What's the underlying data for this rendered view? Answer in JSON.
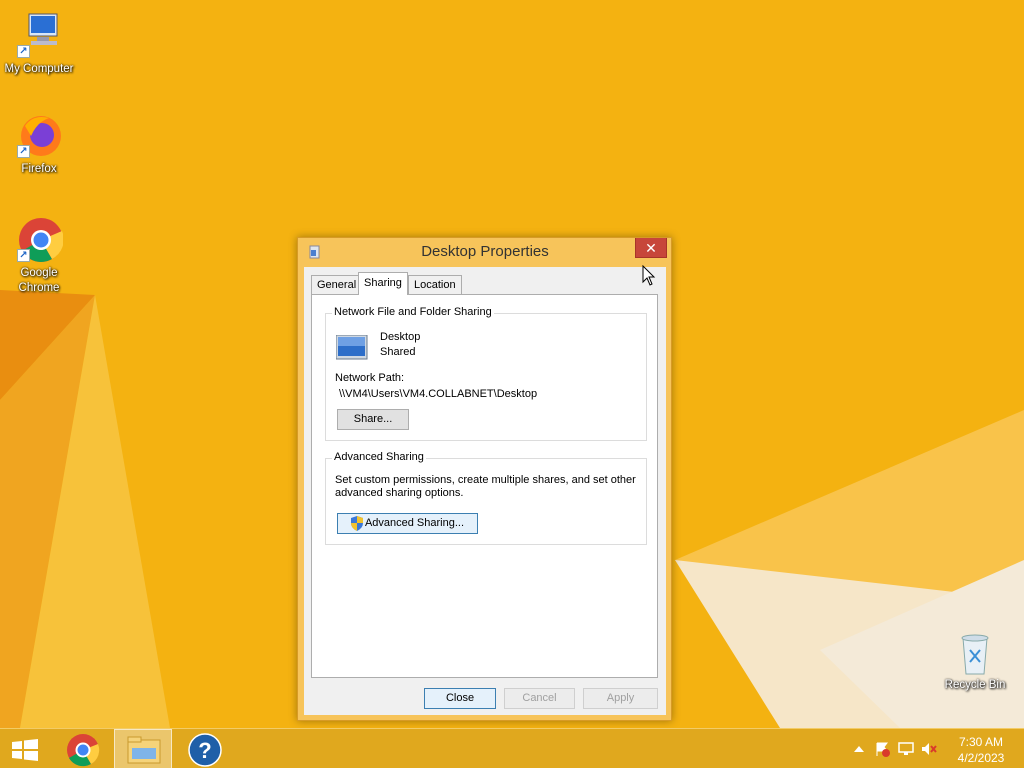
{
  "desktop": {
    "background_color": "#f4b211",
    "icons": [
      {
        "label": "My Computer",
        "icon": "computer-icon"
      },
      {
        "label": "Firefox",
        "icon": "firefox-icon"
      },
      {
        "label": "Google Chrome",
        "icon": "chrome-icon"
      },
      {
        "label": "Recycle Bin",
        "icon": "recycle-bin-icon"
      }
    ]
  },
  "window": {
    "title": "Desktop Properties",
    "close_glyph": "✕",
    "tabs": [
      {
        "label": "General",
        "active": false
      },
      {
        "label": "Sharing",
        "active": true
      },
      {
        "label": "Location",
        "active": false
      }
    ],
    "network_sharing": {
      "legend": "Network File and Folder Sharing",
      "folder_name": "Desktop",
      "folder_status": "Shared",
      "path_label": "Network Path:",
      "path_value": "\\\\VM4\\Users\\VM4.COLLABNET\\Desktop",
      "share_button": "Share..."
    },
    "advanced_sharing": {
      "legend": "Advanced Sharing",
      "description_line1": "Set custom permissions, create multiple shares, and set other",
      "description_line2": "advanced sharing options.",
      "button": "Advanced Sharing..."
    },
    "footer": {
      "close": "Close",
      "cancel": "Cancel",
      "apply": "Apply"
    }
  },
  "taskbar": {
    "items": [
      {
        "name": "start",
        "icon": "windows-logo-icon"
      },
      {
        "name": "chrome",
        "icon": "chrome-icon"
      },
      {
        "name": "file-explorer",
        "icon": "folder-icon",
        "active": true
      },
      {
        "name": "help",
        "icon": "help-icon"
      }
    ],
    "tray": {
      "icons": [
        "chevron-up-icon",
        "action-center-flag-icon",
        "network-icon",
        "speaker-muted-icon"
      ],
      "time": "7:30 AM",
      "date": "4/2/2023"
    }
  }
}
